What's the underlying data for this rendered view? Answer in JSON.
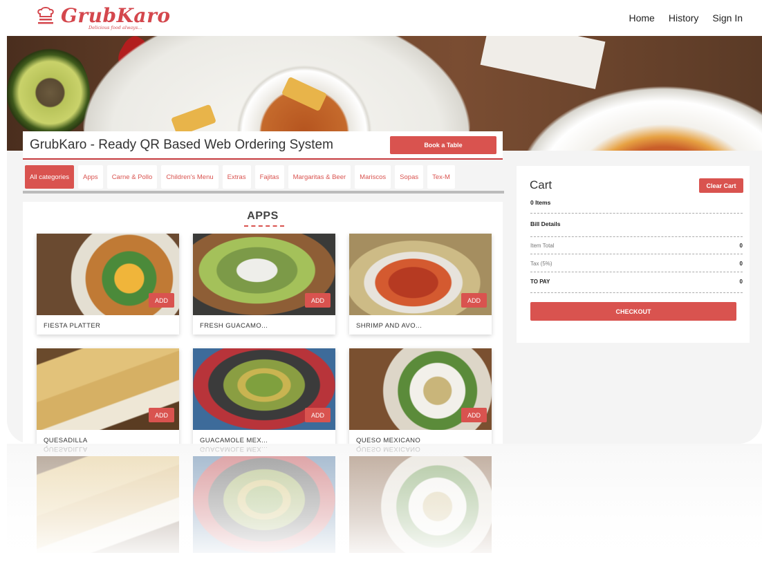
{
  "header": {
    "brand_name": "GrubKaro",
    "brand_tagline": "Delicious food always...",
    "nav": [
      "Home",
      "History",
      "Sign In"
    ]
  },
  "titlebar": {
    "title": "GrubKaro - Ready QR Based Web Ordering System",
    "book_label": "Book a Table"
  },
  "categories": [
    "All categories",
    "Apps",
    "Carne & Pollo",
    "Children's Menu",
    "Extras",
    "Fajitas",
    "Margaritas & Beer",
    "Mariscos",
    "Sopas",
    "Tex-M"
  ],
  "active_category": "All categories",
  "menu": {
    "section_title": "APPS",
    "add_label": "ADD",
    "items": [
      {
        "name": "FIESTA PLATTER"
      },
      {
        "name": "FRESH GUACAMO..."
      },
      {
        "name": "SHRIMP AND AVO..."
      },
      {
        "name": "QUESADILLA"
      },
      {
        "name": "GUACAMOLE MEX..."
      },
      {
        "name": "QUESO MEXICANO"
      }
    ]
  },
  "cart": {
    "title": "Cart",
    "clear_label": "Clear Cart",
    "items_count": "0 Items",
    "bill_details": "Bill Details",
    "item_total_label": "Item Total",
    "item_total": "0",
    "tax_label": "Tax (5%)",
    "tax": "0",
    "to_pay_label": "TO PAY",
    "to_pay": "0",
    "checkout_label": "CHECKOUT"
  },
  "colors": {
    "accent": "#d9534f",
    "brand": "#d4474d"
  }
}
